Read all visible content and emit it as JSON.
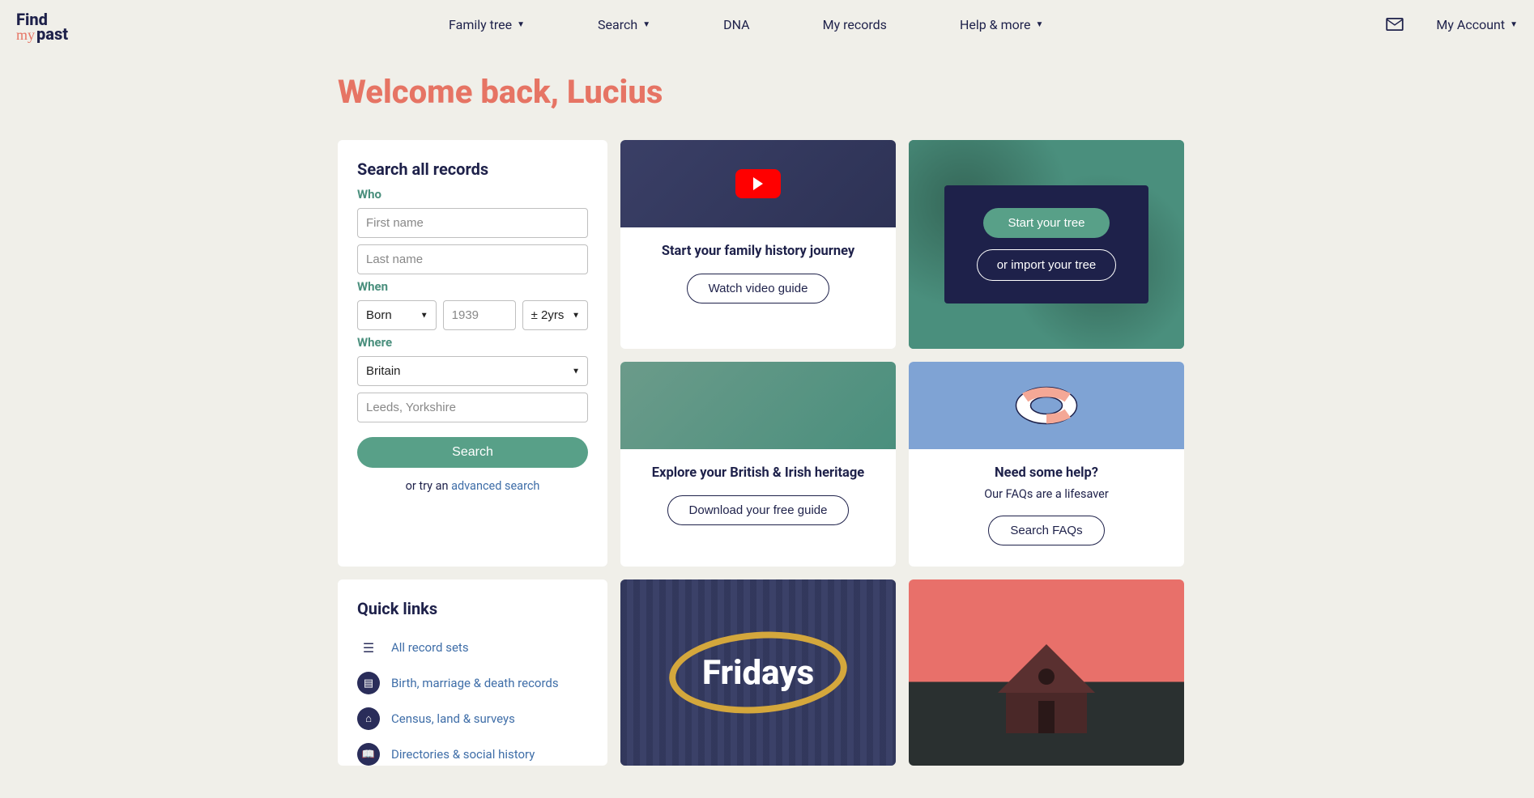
{
  "nav": {
    "family_tree": "Family tree",
    "search": "Search",
    "dna": "DNA",
    "my_records": "My records",
    "help": "Help & more",
    "account": "My Account"
  },
  "logo": {
    "line1": "Find",
    "my": "my",
    "past": "past"
  },
  "welcome": "Welcome back, Lucius",
  "search_card": {
    "title": "Search all records",
    "who": "Who",
    "first_name_ph": "First name",
    "last_name_ph": "Last name",
    "when": "When",
    "born_sel": "Born",
    "year_ph": "1939",
    "tol_sel": "± 2yrs",
    "where": "Where",
    "country_sel": "Britain",
    "place_ph": "Leeds, Yorkshire",
    "search_btn": "Search",
    "or_try_pre": "or try an ",
    "adv_link": "advanced search"
  },
  "video_card": {
    "title": "Start your family history journey",
    "btn": "Watch video guide"
  },
  "tree_card": {
    "start": "Start your tree",
    "import": "or import your tree"
  },
  "heritage_card": {
    "title": "Explore your British & Irish heritage",
    "btn": "Download your free guide"
  },
  "help_card": {
    "title": "Need some help?",
    "sub": "Our FAQs are a lifesaver",
    "btn": "Search FAQs"
  },
  "quick": {
    "title": "Quick links",
    "all": "All record sets",
    "bmd": "Birth, marriage & death records",
    "census": "Census, land & surveys",
    "dir": "Directories & social history"
  },
  "fridays": "Fridays"
}
